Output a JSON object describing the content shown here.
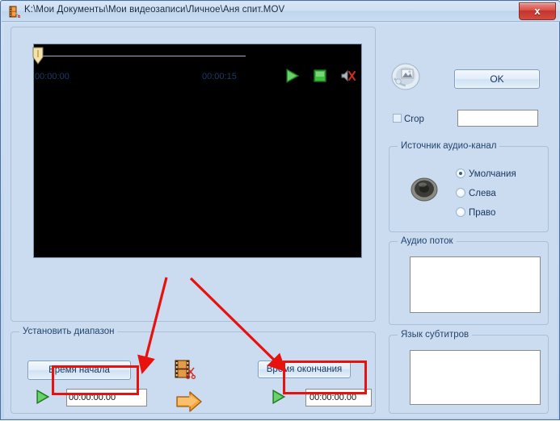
{
  "window": {
    "title": "K:\\Мои Документы\\Мои видеозаписи\\Личное\\Аня спит.MOV",
    "app_icon": "film-app-icon",
    "close_label": "x"
  },
  "video_panel": {
    "name": "video-preview",
    "time_start": "00:00:00",
    "time_end": "00:00:15",
    "controls": [
      {
        "name": "play-button",
        "icon": "play-icon"
      },
      {
        "name": "stop-button",
        "icon": "stop-icon"
      },
      {
        "name": "mute-button",
        "icon": "mute-speaker-icon"
      }
    ]
  },
  "right_panel": {
    "media_icon": "media-converter-icon",
    "ok_label": "OK",
    "crop_label": "Crop",
    "crop_checked": false,
    "crop_value": "",
    "audio_source": {
      "title": "Источник аудио-канал",
      "speaker_icon": "speaker-icon",
      "options": [
        {
          "label": "Умолчания",
          "selected": true
        },
        {
          "label": "Слева",
          "selected": false
        },
        {
          "label": "Право",
          "selected": false
        }
      ]
    },
    "audio_stream": {
      "title": "Аудио поток",
      "items": []
    },
    "subtitles": {
      "title": "Язык субтитров",
      "items": []
    }
  },
  "range_panel": {
    "title": "Установить диапазон",
    "start_button_label": "Время начала",
    "end_button_label": "Время окончания",
    "start_time_value": "00:00:00.00",
    "end_time_value": "00:00:00.00",
    "filmcut_icon": "film-cut-icon",
    "convert_icon": "orange-arrow-icon",
    "start_preview_icon": "play-icon",
    "end_preview_icon": "play-icon"
  },
  "annotations": {
    "highlight_color": "#e8110e",
    "boxes": [
      "start-time-field-highlight",
      "end-time-field-highlight"
    ],
    "arrows": [
      "arrow-to-start-time",
      "arrow-to-end-time"
    ]
  }
}
